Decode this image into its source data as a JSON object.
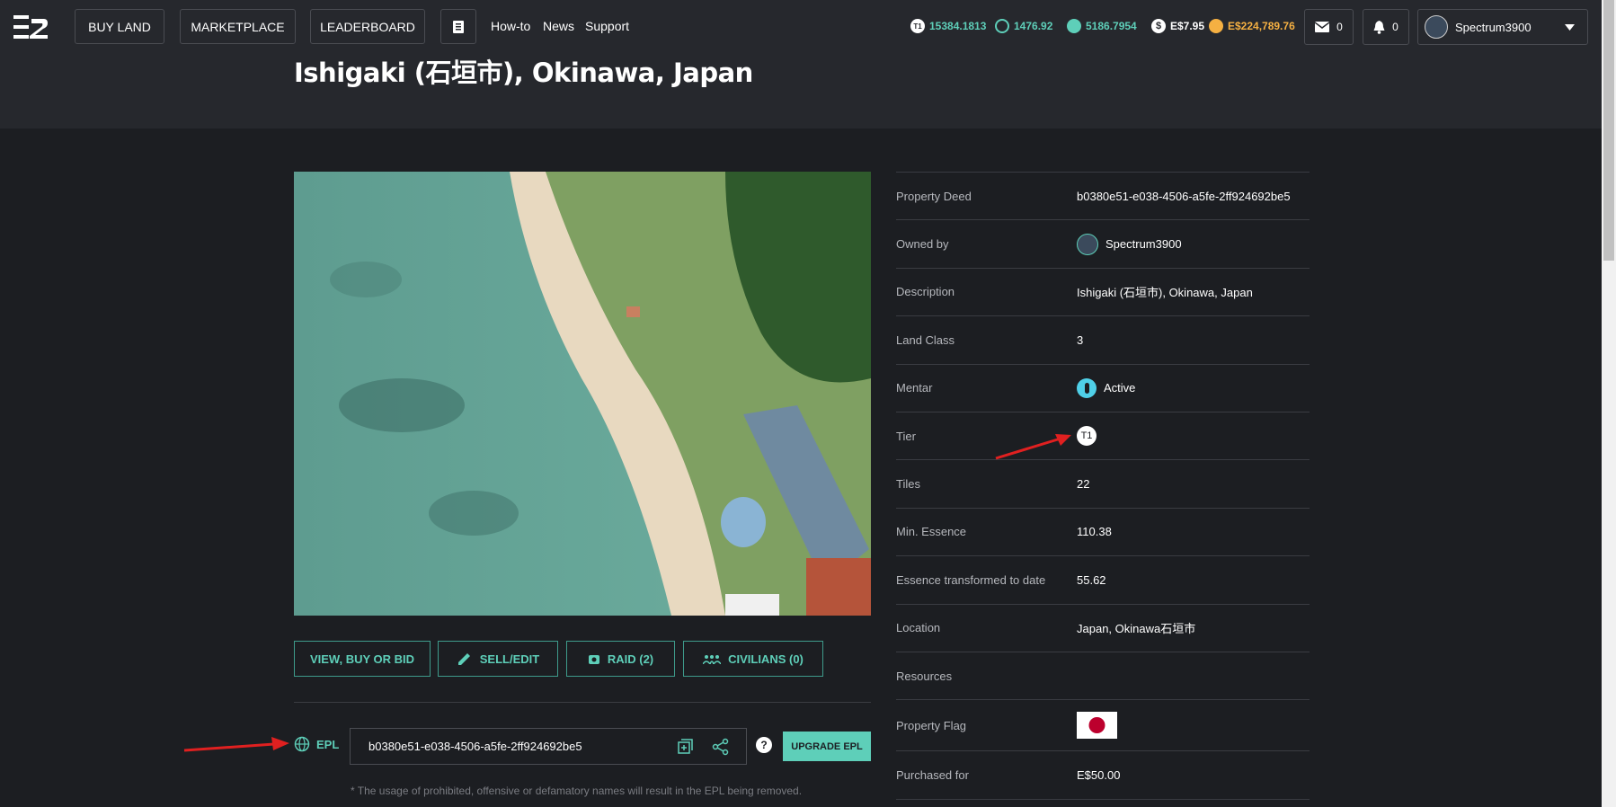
{
  "nav": {
    "buy_land": "BUY LAND",
    "marketplace": "MARKETPLACE",
    "leaderboard": "LEADERBOARD",
    "howto": "How-to",
    "news": "News",
    "support": "Support"
  },
  "currencies": [
    {
      "icon": "t1-icon",
      "value": "15384.1813",
      "color": "#5ecfb9"
    },
    {
      "icon": "essence-icon",
      "value": "1476.92",
      "color": "#5ecfb9"
    },
    {
      "icon": "gem-icon",
      "value": "5186.7954",
      "color": "#5ecfb9"
    },
    {
      "icon": "dollar-icon",
      "value": "E$7.95",
      "color": "#ffffff"
    },
    {
      "icon": "coin-icon",
      "value": "E$224,789.76",
      "color": "#f5b042"
    }
  ],
  "mail_count": "0",
  "notif_count": "0",
  "user": {
    "name": "Spectrum3900"
  },
  "page": {
    "title": "Ishigaki (石垣市), Okinawa, Japan"
  },
  "actions": {
    "view": "VIEW, BUY OR BID",
    "sell": "SELL/EDIT",
    "raid": "RAID (2)",
    "civilians": "CIVILIANS (0)"
  },
  "epl": {
    "label": "EPL",
    "value": "b0380e51-e038-4506-a5fe-2ff924692be5",
    "help": "?",
    "upgrade": "UPGRADE EPL",
    "note": "* The usage of prohibited, offensive or defamatory names will result in the EPL being removed."
  },
  "properties": [
    {
      "key": "Property Deed",
      "value": "b0380e51-e038-4506-a5fe-2ff924692be5"
    },
    {
      "key": "Owned by",
      "value": "Spectrum3900"
    },
    {
      "key": "Description",
      "value": "Ishigaki (石垣市), Okinawa, Japan"
    },
    {
      "key": "Land Class",
      "value": "3"
    },
    {
      "key": "Mentar",
      "value": "Active"
    },
    {
      "key": "Tier",
      "value": "T1"
    },
    {
      "key": "Tiles",
      "value": "22"
    },
    {
      "key": "Min. Essence",
      "value": "110.38"
    },
    {
      "key": "Essence transformed to date",
      "value": "55.62"
    },
    {
      "key": "Location",
      "value": "Japan, Okinawa石垣市"
    },
    {
      "key": "Resources",
      "value": ""
    },
    {
      "key": "Property Flag",
      "value": ""
    },
    {
      "key": "Purchased for",
      "value": "E$50.00"
    }
  ]
}
